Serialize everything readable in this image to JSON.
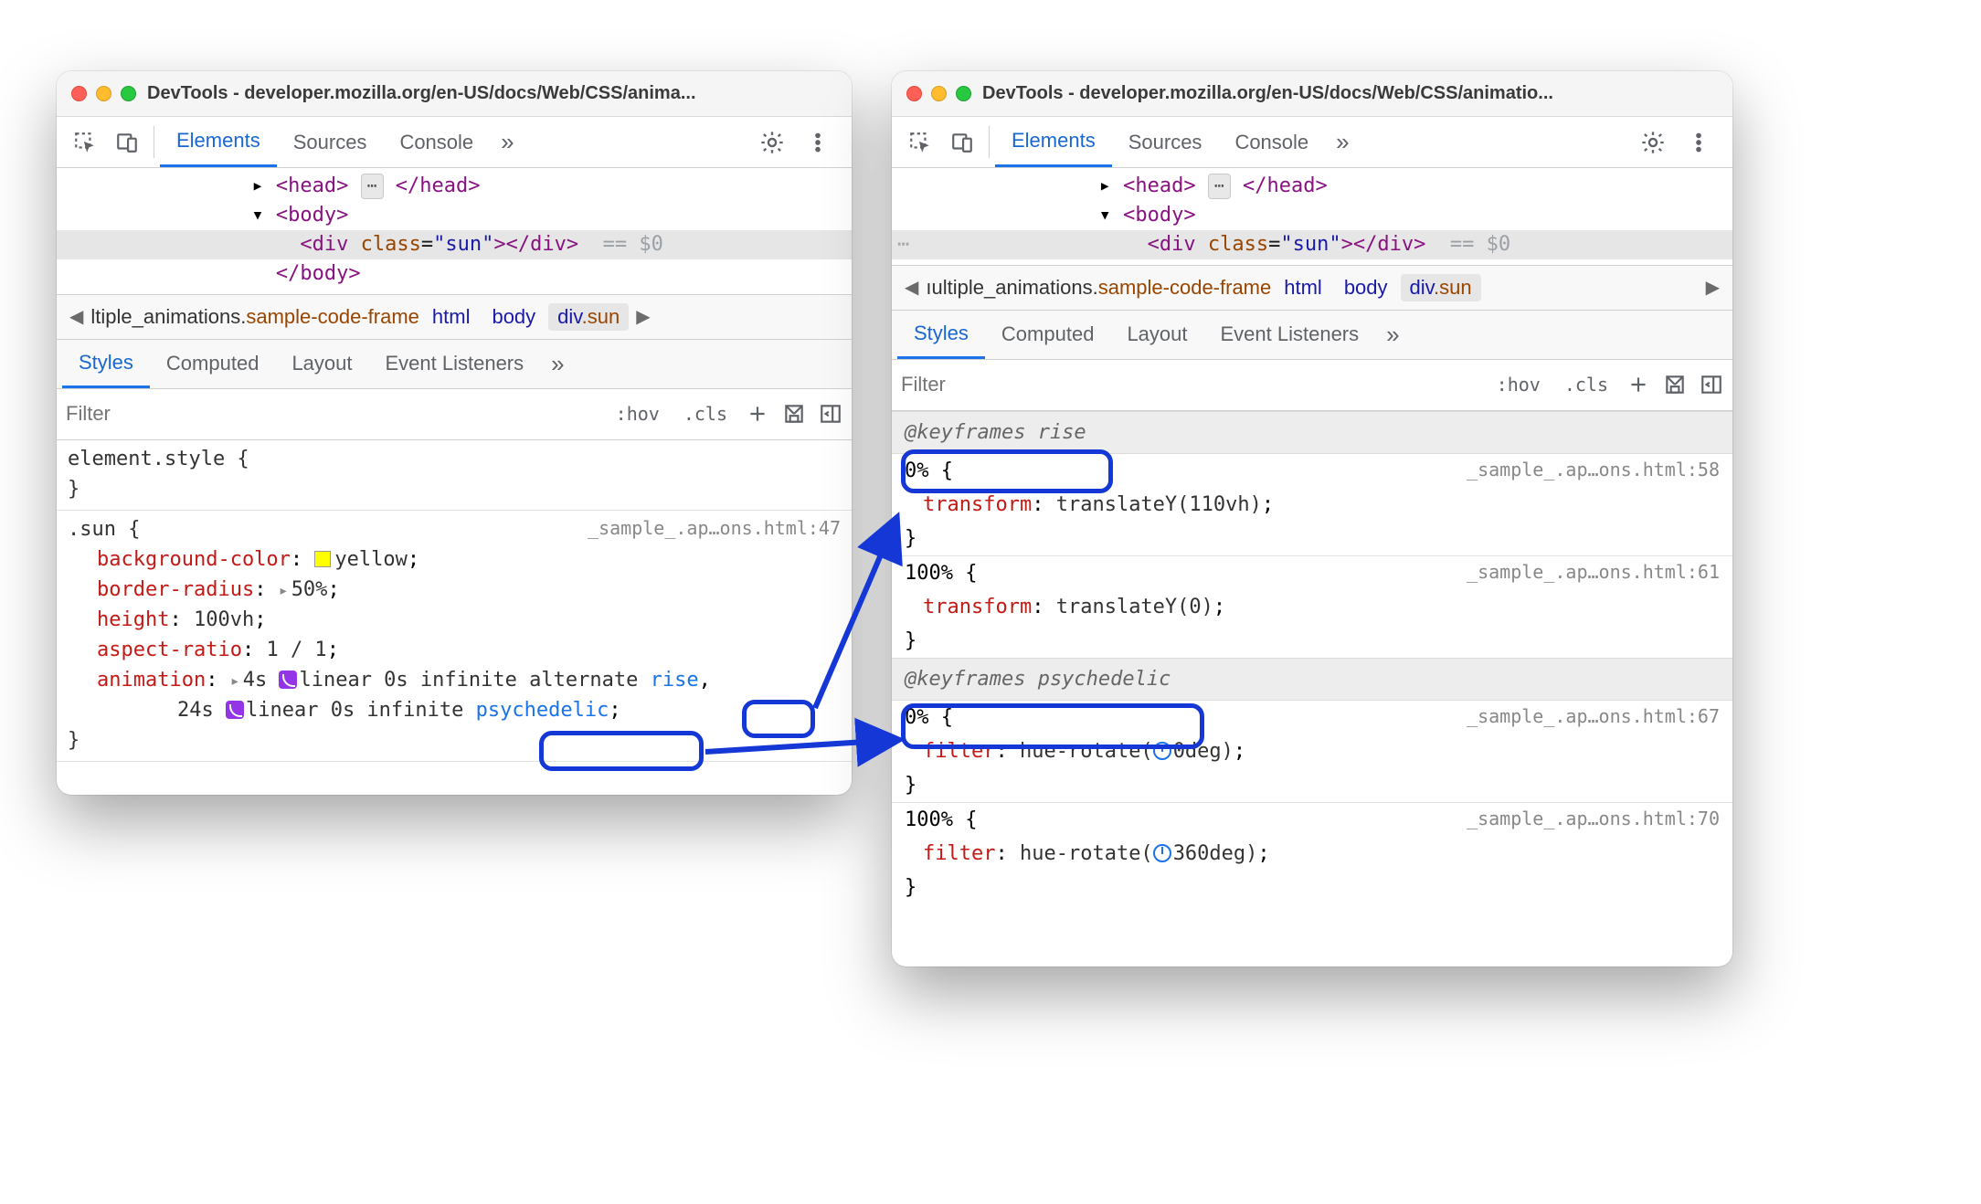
{
  "left_window": {
    "title": "DevTools - developer.mozilla.org/en-US/docs/Web/CSS/anima...",
    "toolbar_tabs": {
      "elements": "Elements",
      "sources": "Sources",
      "console": "Console"
    },
    "dom": {
      "head_open": "<head>",
      "head_close": "</head>",
      "body_open": "<body>",
      "div_open": "<div ",
      "div_class_attr": "class",
      "div_class_val": "\"sun\"",
      "div_close": "></div>",
      "eq0": "== $0",
      "body_close": "</body>"
    },
    "crumbs": {
      "lead_plain": "ltiple_animations.",
      "lead_cls": "sample-code-frame",
      "html": "html",
      "body": "body",
      "div_tag": "div",
      "div_cls": ".sun"
    },
    "subtabs": {
      "styles": "Styles",
      "computed": "Computed",
      "layout": "Layout",
      "listeners": "Event Listeners"
    },
    "filter_placeholder": "Filter",
    "filter_tools": {
      "hov": ":hov",
      "cls": ".cls"
    },
    "style_elem": {
      "sel": "element.style {",
      "close": "}"
    },
    "style_sun": {
      "sel": ".sun {",
      "src": "_sample_.ap…ons.html:47",
      "bg_name": "background-color",
      "bg_val": "yellow",
      "br_name": "border-radius",
      "br_val": "50%",
      "h_name": "height",
      "h_val": "100vh",
      "ar_name": "aspect-ratio",
      "ar_val": "1 / 1",
      "anim_name": "animation",
      "anim_part1_pre": "4s ",
      "anim_part1_post": "linear 0s infinite alternate ",
      "anim_rise": "rise",
      "anim_part2_pre": "24s ",
      "anim_part2_post": "linear 0s infinite ",
      "anim_psy": "psychedelic",
      "close": "}"
    }
  },
  "right_window": {
    "title": "DevTools - developer.mozilla.org/en-US/docs/Web/CSS/animatio...",
    "crumbs": {
      "lead_plain": "ıultiple_animations.",
      "lead_cls": "sample-code-frame",
      "html": "html",
      "body": "body",
      "div_tag": "div",
      "div_cls": ".sun"
    },
    "kf_rise": {
      "header": "@keyframes rise",
      "p0_src": "_sample_.ap…ons.html:58",
      "p0_open": "0% {",
      "p0_name": "transform",
      "p0_val": "translateY(110vh)",
      "p0_close": "}",
      "p100_src": "_sample_.ap…ons.html:61",
      "p100_open": "100% {",
      "p100_name": "transform",
      "p100_val": "translateY(0)",
      "p100_close": "}"
    },
    "kf_psy": {
      "header": "@keyframes psychedelic",
      "p0_src": "_sample_.ap…ons.html:67",
      "p0_open": "0% {",
      "p0_name": "filter",
      "p0_val_pre": "hue-rotate(",
      "p0_val_num": "0deg",
      "p0_val_post": ")",
      "p0_close": "}",
      "p100_src": "_sample_.ap…ons.html:70",
      "p100_open": "100% {",
      "p100_name": "filter",
      "p100_val_pre": "hue-rotate(",
      "p100_val_num": "360deg",
      "p100_val_post": ")",
      "p100_close": "}"
    }
  },
  "shared": {
    "subtabs": {
      "styles": "Styles",
      "computed": "Computed",
      "layout": "Layout",
      "listeners": "Event Listeners"
    },
    "filter_placeholder": "Filter",
    "filter_tools": {
      "hov": ":hov",
      "cls": ".cls"
    },
    "toolbar_tabs": {
      "elements": "Elements",
      "sources": "Sources",
      "console": "Console"
    }
  }
}
